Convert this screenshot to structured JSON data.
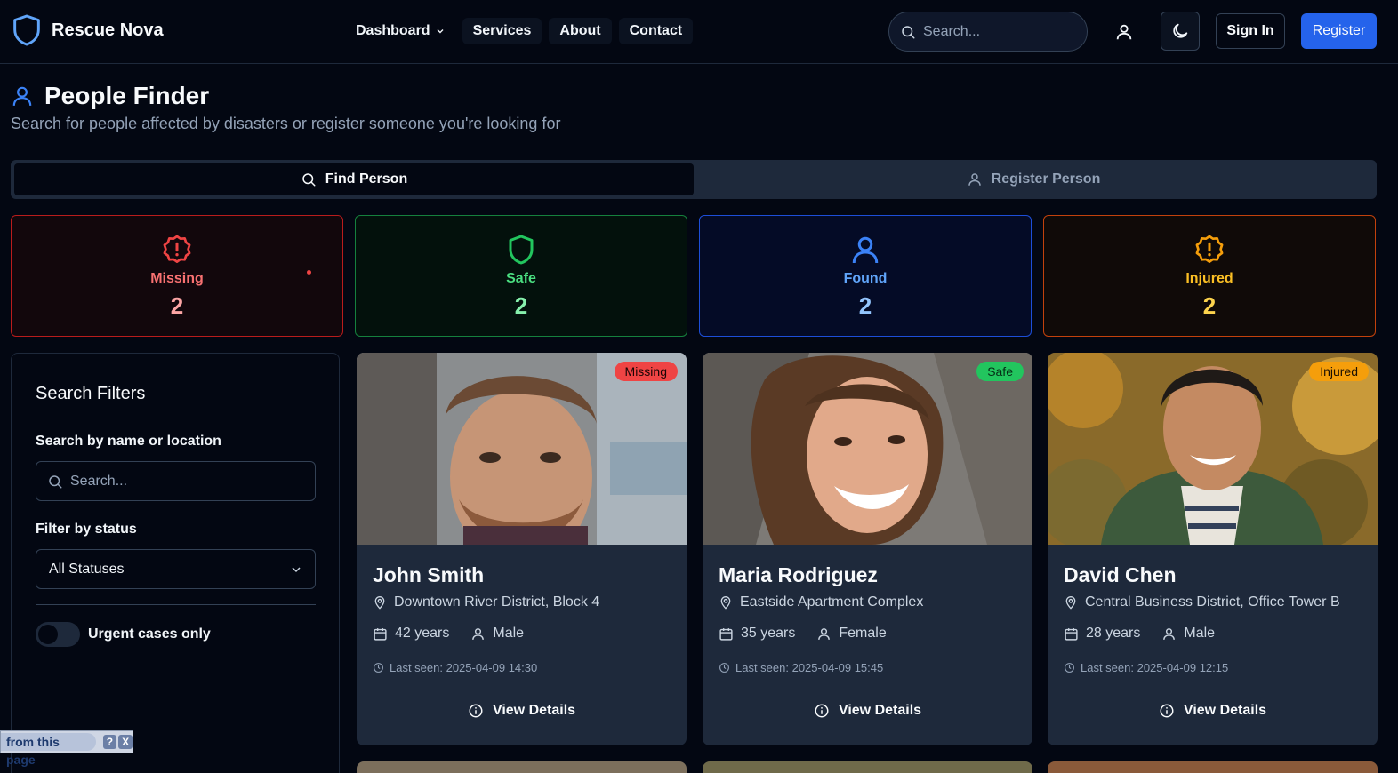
{
  "nav": {
    "brand": "Rescue Nova",
    "links": [
      "Dashboard",
      "Services",
      "About",
      "Contact"
    ],
    "search_placeholder": "Search...",
    "sign_in": "Sign In",
    "register": "Register"
  },
  "header": {
    "title": "People Finder",
    "subtitle": "Search for people affected by disasters or register someone you're looking for"
  },
  "tabs": [
    {
      "label": "Find Person",
      "active": true
    },
    {
      "label": "Register Person",
      "active": false
    }
  ],
  "stats": [
    {
      "label": "Missing",
      "count": "2",
      "color": "#ef4444"
    },
    {
      "label": "Safe",
      "count": "2",
      "color": "#22c55e"
    },
    {
      "label": "Found",
      "count": "2",
      "color": "#3b82f6"
    },
    {
      "label": "Injured",
      "count": "2",
      "color": "#f59e0b"
    }
  ],
  "filters": {
    "title": "Search Filters",
    "search_label": "Search by name or location",
    "search_placeholder": "Search...",
    "status_label": "Filter by status",
    "status_value": "All Statuses",
    "urgent_label": "Urgent cases only",
    "urgent_on": false
  },
  "people": [
    {
      "name": "John Smith",
      "status": "Missing",
      "location": "Downtown River District, Block 4",
      "age": "42 years",
      "gender": "Male",
      "last_seen": "Last seen: 2025-04-09 14:30",
      "button": "View Details"
    },
    {
      "name": "Maria Rodriguez",
      "status": "Safe",
      "location": "Eastside Apartment Complex",
      "age": "35 years",
      "gender": "Female",
      "last_seen": "Last seen: 2025-04-09 15:45",
      "button": "View Details"
    },
    {
      "name": "David Chen",
      "status": "Injured",
      "location": "Central Business District, Office Tower B",
      "age": "28 years",
      "gender": "Male",
      "last_seen": "Last seen: 2025-04-09 12:15",
      "button": "View Details"
    }
  ],
  "helper": {
    "text": "from this page",
    "help": "?",
    "close": "X"
  },
  "colors": {
    "accent": "#2563eb",
    "background": "#030712",
    "card": "#1e293b"
  }
}
